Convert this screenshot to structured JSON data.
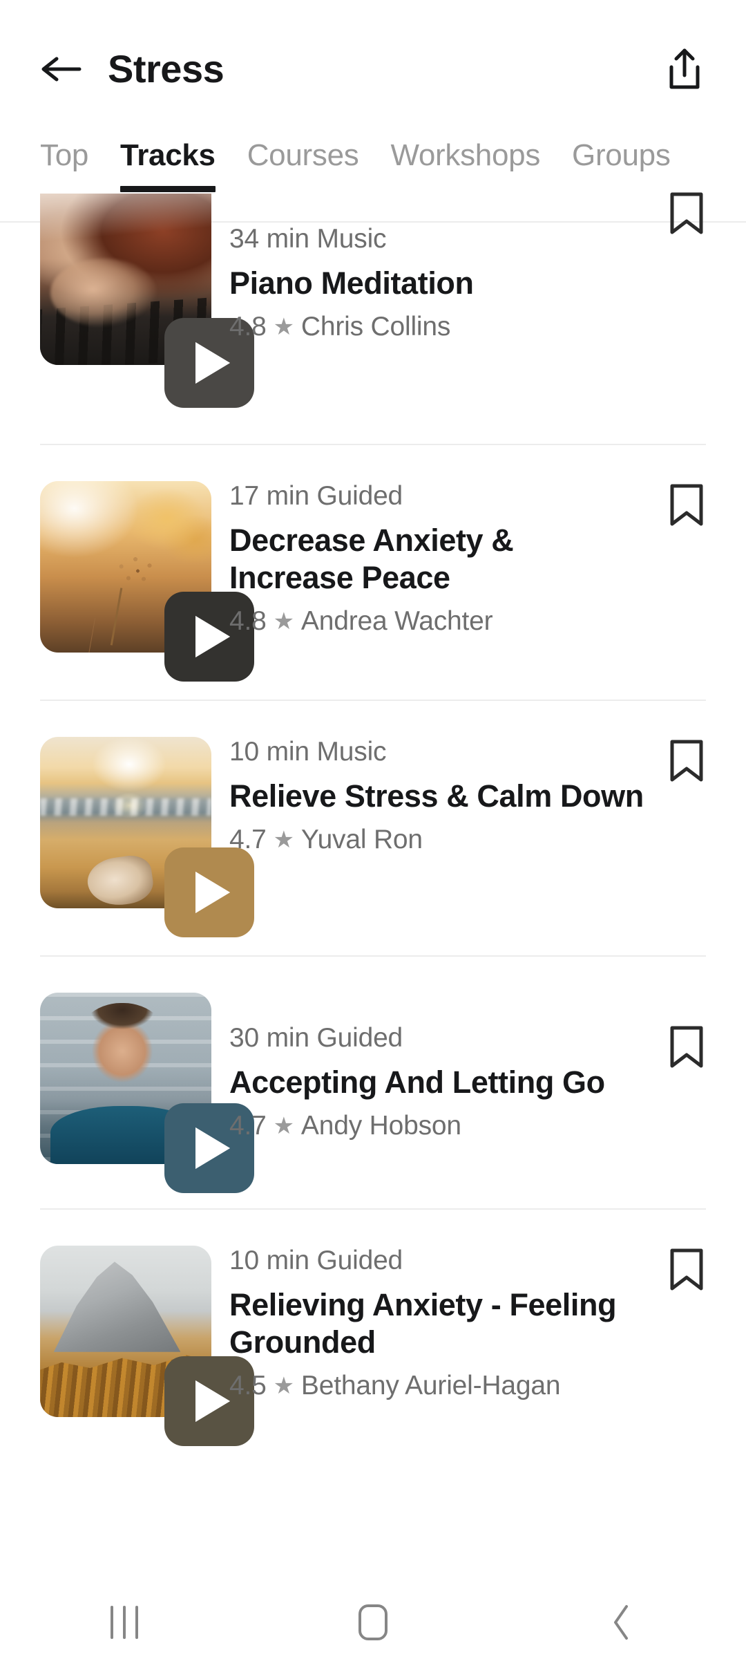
{
  "header": {
    "title": "Stress",
    "back_icon": "arrow-left-icon",
    "share_icon": "share-icon"
  },
  "tabs": [
    {
      "label": "Top",
      "active": false
    },
    {
      "label": "Tracks",
      "active": true
    },
    {
      "label": "Courses",
      "active": false
    },
    {
      "label": "Workshops",
      "active": false
    },
    {
      "label": "Groups",
      "active": false
    }
  ],
  "tracks": [
    {
      "meta": "34 min Music",
      "title": "Piano Meditation",
      "rating": "4.8",
      "star": "★",
      "author": "Chris Collins",
      "play_icon": "play-icon",
      "bookmark_icon": "bookmark-icon",
      "thumb_alt": "piano-keys-thumbnail",
      "play_button_color": "#4a4845"
    },
    {
      "meta": "17 min Guided",
      "title": "Decrease Anxiety & Increase Peace",
      "rating": "4.8",
      "star": "★",
      "author": "Andrea Wachter",
      "play_icon": "play-icon",
      "bookmark_icon": "bookmark-icon",
      "thumb_alt": "sunset-field-flower-thumbnail",
      "play_button_color": "#33322f"
    },
    {
      "meta": "10 min Music",
      "title": "Relieve Stress & Calm Down",
      "rating": "4.7",
      "star": "★",
      "author": "Yuval Ron",
      "play_icon": "play-icon",
      "bookmark_icon": "bookmark-icon",
      "thumb_alt": "beach-sunset-shell-thumbnail",
      "play_button_color": "#b08a4f"
    },
    {
      "meta": "30 min Guided",
      "title": "Accepting And Letting Go",
      "rating": "4.7",
      "star": "★",
      "author": "Andy Hobson",
      "play_icon": "play-icon",
      "bookmark_icon": "bookmark-icon",
      "thumb_alt": "man-portrait-thumbnail",
      "play_button_color": "#3c5f70"
    },
    {
      "meta": "10 min Guided",
      "title": "Relieving Anxiety - Feeling Grounded",
      "rating": "4.5",
      "star": "★",
      "author": "Bethany Auriel-Hagan",
      "play_icon": "play-icon",
      "bookmark_icon": "bookmark-icon",
      "thumb_alt": "mountain-autumn-thumbnail",
      "play_button_color": "#595343"
    }
  ],
  "navbar": {
    "recents_label": "recents-icon",
    "home_label": "home-icon",
    "back_label": "back-icon"
  },
  "colors": {
    "text_primary": "#17181a",
    "text_secondary": "#6e6e6e",
    "text_muted": "#9a9a9a",
    "divider": "#ececec",
    "background": "#ffffff"
  }
}
